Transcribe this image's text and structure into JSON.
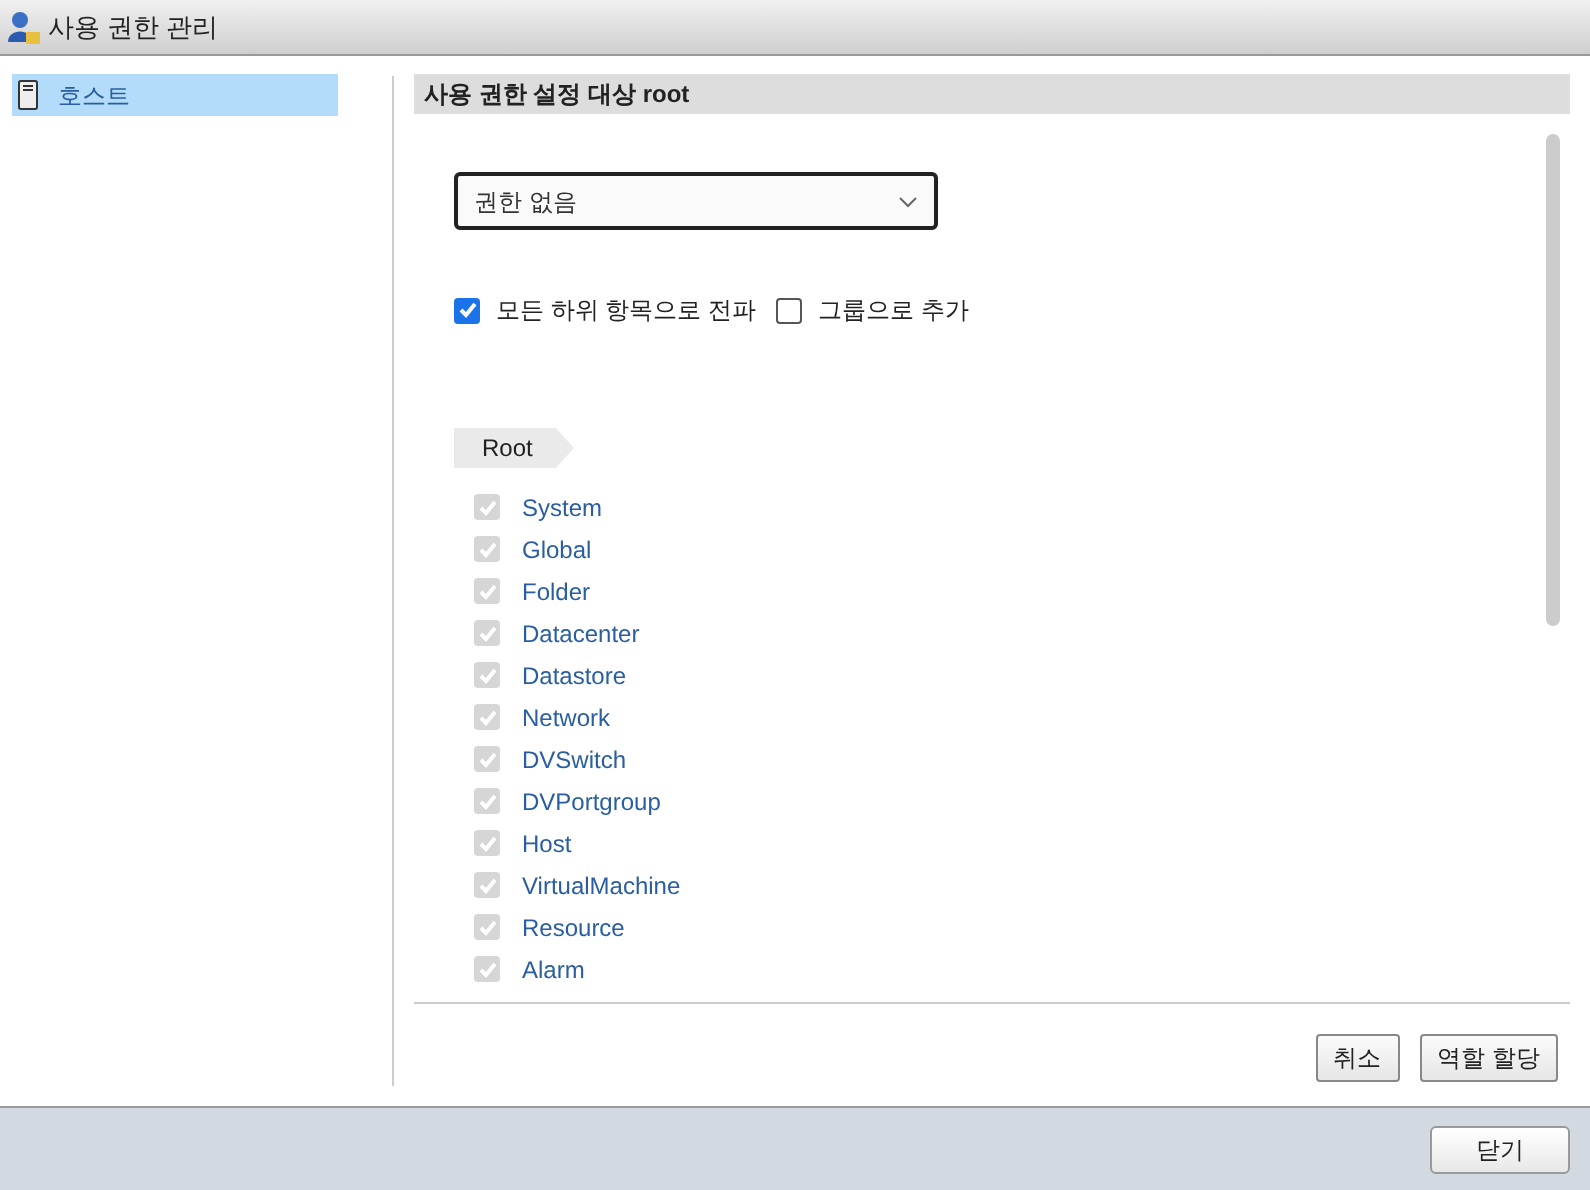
{
  "window": {
    "title": "사용 권한 관리"
  },
  "sidebar": {
    "items": [
      {
        "label": "호스트",
        "selected": true
      }
    ]
  },
  "panel": {
    "header": "사용 권한 설정 대상 root",
    "role_select": {
      "value": "권한 없음"
    },
    "options": [
      {
        "label": "모든 하위 항목으로 전파",
        "checked": true
      },
      {
        "label": "그룹으로 추가",
        "checked": false
      }
    ],
    "breadcrumb": "Root",
    "privileges": [
      {
        "label": "System",
        "checked": true,
        "disabled": true
      },
      {
        "label": "Global",
        "checked": true,
        "disabled": true
      },
      {
        "label": "Folder",
        "checked": true,
        "disabled": true
      },
      {
        "label": "Datacenter",
        "checked": true,
        "disabled": true
      },
      {
        "label": "Datastore",
        "checked": true,
        "disabled": true
      },
      {
        "label": "Network",
        "checked": true,
        "disabled": true
      },
      {
        "label": "DVSwitch",
        "checked": true,
        "disabled": true
      },
      {
        "label": "DVPortgroup",
        "checked": true,
        "disabled": true
      },
      {
        "label": "Host",
        "checked": true,
        "disabled": true
      },
      {
        "label": "VirtualMachine",
        "checked": true,
        "disabled": true
      },
      {
        "label": "Resource",
        "checked": true,
        "disabled": true
      },
      {
        "label": "Alarm",
        "checked": true,
        "disabled": true
      }
    ],
    "buttons": [
      "취소",
      "역할 할당"
    ]
  },
  "footer": {
    "buttons": [
      "닫기"
    ]
  }
}
